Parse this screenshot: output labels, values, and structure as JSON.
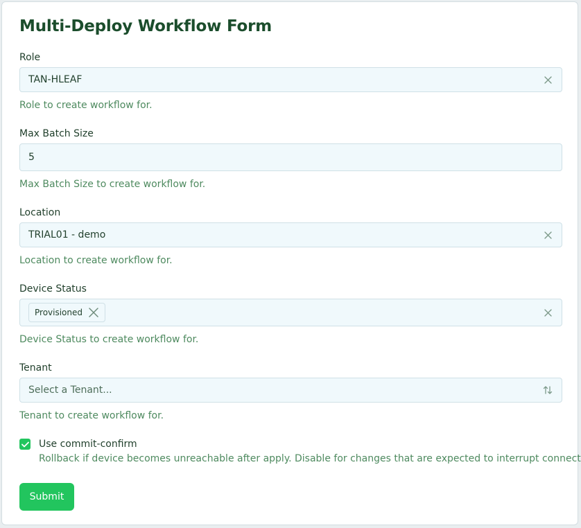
{
  "form": {
    "title": "Multi-Deploy Workflow Form",
    "submit_label": "Submit"
  },
  "role": {
    "label": "Role",
    "value": "TAN-HLEAF",
    "help": "Role to create workflow for."
  },
  "batch": {
    "label": "Max Batch Size",
    "value": "5",
    "help": "Max Batch Size to create workflow for."
  },
  "location": {
    "label": "Location",
    "value": "TRIAL01 - demo",
    "help": "Location to create workflow for."
  },
  "device_status": {
    "label": "Device Status",
    "chips": [
      "Provisioned"
    ],
    "help": "Device Status to create workflow for."
  },
  "tenant": {
    "label": "Tenant",
    "placeholder": "Select a Tenant...",
    "help": "Tenant to create workflow for."
  },
  "commit_confirm": {
    "checked": true,
    "label": "Use commit-confirm",
    "description": "Rollback if device becomes unreachable after apply. Disable for changes that are expected to interrupt connectivity."
  },
  "icons": {
    "clear": "close-icon",
    "chip_remove": "x-icon",
    "select_toggle": "sort-arrows-icon",
    "checkbox": "checkmark-icon"
  },
  "colors": {
    "title": "#1b4d2c",
    "help_text": "#4e8a5f",
    "field_bg": "#f0f9fc",
    "accent": "#22c55e"
  }
}
